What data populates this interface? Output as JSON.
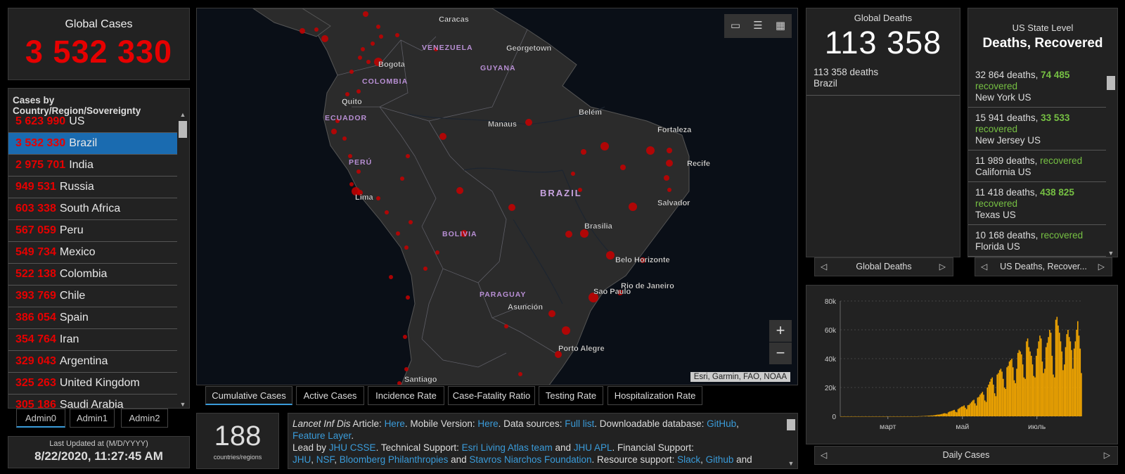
{
  "global_cases": {
    "title": "Global Cases",
    "value": "3 532 330"
  },
  "country_panel": {
    "header": "Cases by Country/Region/Sovereignty",
    "items": [
      {
        "num": "5 623 990",
        "name": "US"
      },
      {
        "num": "3 532 330",
        "name": "Brazil"
      },
      {
        "num": "2 975 701",
        "name": "India"
      },
      {
        "num": "949 531",
        "name": "Russia"
      },
      {
        "num": "603 338",
        "name": "South Africa"
      },
      {
        "num": "567 059",
        "name": "Peru"
      },
      {
        "num": "549 734",
        "name": "Mexico"
      },
      {
        "num": "522 138",
        "name": "Colombia"
      },
      {
        "num": "393 769",
        "name": "Chile"
      },
      {
        "num": "386 054",
        "name": "Spain"
      },
      {
        "num": "354 764",
        "name": "Iran"
      },
      {
        "num": "329 043",
        "name": "Argentina"
      },
      {
        "num": "325 263",
        "name": "United Kingdom"
      },
      {
        "num": "305 186",
        "name": "Saudi Arabia"
      }
    ],
    "selected_name": "Brazil"
  },
  "admin_tabs": [
    "Admin0",
    "Admin1",
    "Admin2"
  ],
  "last_updated": {
    "label": "Last Updated at (M/D/YYYY)",
    "value": "8/22/2020, 11:27:45 AM"
  },
  "map": {
    "labels": {
      "caracas": "Caracas",
      "venezuela": "VENEZUELA",
      "georgetown": "Georgetown",
      "guyana": "GUYANA",
      "bogota": "Bogota",
      "colombia": "COLOMBIA",
      "quito": "Quito",
      "ecuador": "ECUADOR",
      "manaus": "Manaus",
      "belem": "Belém",
      "fortaleza": "Fortaleza",
      "recife": "Recife",
      "peru": "PERÚ",
      "brazil": "BRAZIL",
      "lima": "Lima",
      "salvador": "Salvador",
      "brasilia": "Brasilia",
      "bolivia": "BOLIVIA",
      "belo_horizonte": "Belo Horizonte",
      "rio": "Rio de Janeiro",
      "sao_paulo": "Sao Paulo",
      "paraguay": "PARAGUAY",
      "asuncion": "Asunción",
      "porto_alegre": "Porto Alegre",
      "santiago": "Santiago"
    },
    "attribution": "Esri, Garmin, FAO, NOAA",
    "zoom_in": "+",
    "zoom_out": "−",
    "tool_icons": [
      "bookmark-icon",
      "list-icon",
      "qr-icon"
    ]
  },
  "map_tabs": [
    "Cumulative Cases",
    "Active Cases",
    "Incidence Rate",
    "Case-Fatality Ratio",
    "Testing Rate",
    "Hospitalization Rate"
  ],
  "countries_count": {
    "value": "188",
    "label": "countries/regions"
  },
  "info": {
    "lancet": "Lancet Inf Dis",
    "t1": " Article: ",
    "here1": "Here",
    "t2": ". Mobile Version: ",
    "here2": "Here",
    "t3": ". Data sources: ",
    "full_list": "Full list",
    "t4": ". Downloadable database: ",
    "github": "GitHub",
    "t5": ", ",
    "feature_layer": "Feature Layer",
    "t6": ".",
    "t7": "Lead by ",
    "jhu_csse": "JHU CSSE",
    "t8": ". Technical Support: ",
    "esri_team": "Esri Living Atlas team",
    "t9": " and ",
    "jhu_apl": "JHU APL",
    "t10": ". Financial Support:",
    "jhu": "JHU",
    "t11": ", ",
    "nsf": "NSF",
    "t12": ", ",
    "bloomberg": "Bloomberg Philanthropies",
    "t13": " and ",
    "stavros": "Stavros Niarchos Foundation",
    "t14": ". Resource support: ",
    "slack": "Slack",
    "t15": ", ",
    "github2": "Github",
    "t16": " and"
  },
  "global_deaths": {
    "title": "Global Deaths",
    "value": "113 358",
    "sub_line1": "113 358 deaths",
    "sub_line2": "Brazil",
    "pager_label": "Global Deaths"
  },
  "us_panel": {
    "title1": "US State Level",
    "title2": "Deaths, Recovered",
    "items": [
      {
        "deaths": "32 864 deaths, ",
        "recovered_num": "74 485",
        "recovered_label": "recovered",
        "state": "New York US"
      },
      {
        "deaths": "15 941 deaths, ",
        "recovered_num": "33 533",
        "recovered_label": "recovered",
        "state": "New Jersey US"
      },
      {
        "deaths": "11 989 deaths, ",
        "recovered_num": "",
        "recovered_label": " recovered",
        "state": "California US"
      },
      {
        "deaths": "11 418 deaths, ",
        "recovered_num": "438 825",
        "recovered_label": "recovered",
        "state": "Texas US"
      },
      {
        "deaths": "10 168 deaths, ",
        "recovered_num": "",
        "recovered_label": " recovered",
        "state": "Florida US"
      }
    ],
    "pager_label": "US Deaths, Recover..."
  },
  "chart_data": {
    "type": "bar",
    "ylim": [
      0,
      80000
    ],
    "yticks": [
      "0",
      "20k",
      "40k",
      "60k",
      "80k"
    ],
    "xticks": [
      "март",
      "май",
      "июль"
    ],
    "color": "#f5a800",
    "values": [
      0,
      0,
      0,
      0,
      0,
      0,
      0,
      0,
      0,
      0,
      0,
      0,
      0,
      0,
      0,
      0,
      0,
      0,
      0,
      0,
      0,
      0,
      0,
      0,
      0,
      0,
      0,
      0,
      0,
      0,
      0,
      0,
      0,
      0,
      0,
      0,
      0,
      0,
      0,
      0,
      0,
      0,
      0,
      0,
      0,
      0,
      0,
      0,
      0,
      0,
      0,
      0,
      0,
      0,
      0,
      0,
      0,
      0,
      0,
      0,
      0,
      0,
      0,
      0,
      100,
      100,
      150,
      200,
      200,
      300,
      300,
      400,
      500,
      500,
      600,
      600,
      700,
      800,
      1000,
      1200,
      1200,
      1300,
      1500,
      1700,
      2000,
      2200,
      2000,
      1800,
      2800,
      3300,
      3500,
      3800,
      4200,
      4500,
      3200,
      2800,
      5000,
      5600,
      6200,
      6800,
      7000,
      7600,
      6000,
      5000,
      7700,
      8000,
      9000,
      10000,
      11000,
      11500,
      9000,
      7500,
      13000,
      13500,
      15000,
      16000,
      17000,
      15000,
      11000,
      10000,
      20000,
      22000,
      24000,
      26000,
      27000,
      22000,
      16000,
      14000,
      29000,
      30000,
      32000,
      33000,
      31000,
      26000,
      20000,
      19000,
      34000,
      35000,
      38000,
      39000,
      40000,
      34000,
      25000,
      23000,
      33000,
      44000,
      46000,
      45000,
      43000,
      36000,
      27000,
      26000,
      52000,
      54000,
      48000,
      45000,
      42000,
      36000,
      28000,
      27000,
      42000,
      47000,
      52000,
      56000,
      54000,
      38000,
      30000,
      33000,
      48000,
      51000,
      55000,
      60000,
      58000,
      42000,
      29000,
      27000,
      67000,
      69000,
      63000,
      58000,
      52000,
      45000,
      32000,
      36000,
      48000,
      57000,
      60000,
      55000,
      52000,
      46000,
      33000,
      47000,
      52000,
      60000,
      66000,
      56000,
      47000,
      30000
    ],
    "dates_start": "2020-01-22",
    "title": "Daily Cases"
  }
}
